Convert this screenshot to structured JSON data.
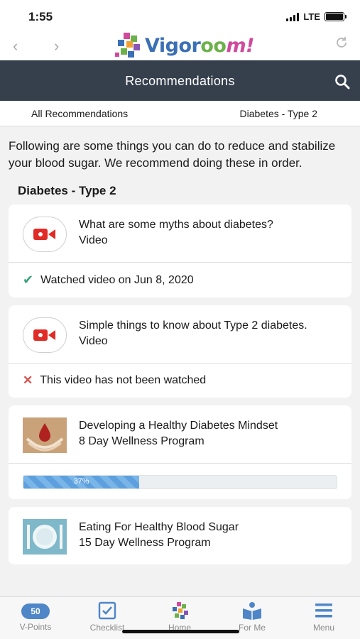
{
  "status": {
    "time": "1:55",
    "network": "LTE"
  },
  "app": {
    "logo_text_a": "Vigor",
    "logo_text_b": "oo",
    "logo_text_c": "m!",
    "back_icon": "chevron-left-icon",
    "forward_icon": "chevron-right-icon",
    "reload_icon": "reload-icon"
  },
  "header": {
    "title": "Recommendations",
    "search_icon": "search-icon"
  },
  "tabs": [
    {
      "label": "All Recommendations"
    },
    {
      "label": "Diabetes - Type 2"
    }
  ],
  "intro": "Following are some things you can do to reduce and stabilize your blood sugar. We recommend doing these in order.",
  "section_title": "Diabetes - Type 2",
  "cards": [
    {
      "title": "What are some myths about diabetes?",
      "type": "Video",
      "status": "Watched video on Jun 8, 2020",
      "status_kind": "watched"
    },
    {
      "title": "Simple things to know about Type 2 diabetes.",
      "type": "Video",
      "status": "This video has not been watched",
      "status_kind": "not-watched"
    },
    {
      "title": "Developing a Healthy Diabetes Mindset",
      "type": "8 Day Wellness Program",
      "progress_label": "37%",
      "progress": 0.37
    },
    {
      "title": "Eating For Healthy Blood Sugar",
      "type": "15 Day Wellness Program"
    }
  ],
  "bottom_nav": [
    {
      "label": "V-Points",
      "badge": "50"
    },
    {
      "label": "Checklist"
    },
    {
      "label": "Home"
    },
    {
      "label": "For Me"
    },
    {
      "label": "Menu"
    }
  ],
  "colors": {
    "header_bg": "#36404d",
    "accent": "#4e86c8",
    "check": "#3aa37a",
    "cross": "#d9534f",
    "video_red": "#e02b27"
  }
}
